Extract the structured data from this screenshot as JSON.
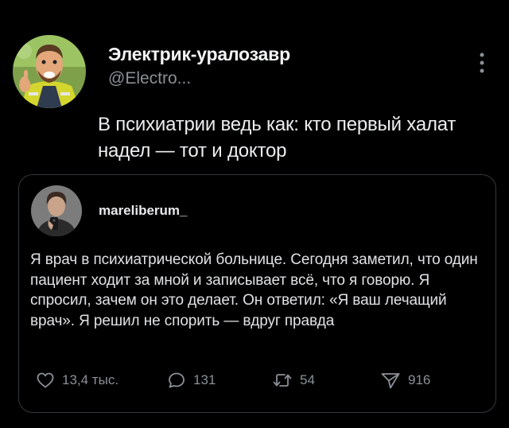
{
  "post": {
    "author_name": "Электрик-уралозавр",
    "author_handle": "@Electro...",
    "text": "В психиатрии ведь как: кто первый халат надел — тот и доктор",
    "avatar_icon": "cartoon-electrician-avatar-icon",
    "menu_icon": "vertical-ellipsis-icon"
  },
  "quote": {
    "author_name": "mareliberum_",
    "avatar_icon": "profile-photo-avatar-icon",
    "text": "Я врач в психиатрической больнице. Сегодня заметил, что один пациент ходит за мной и записывает всё, что я говорю. Я спросил, зачем он это делает. Он ответил: «Я ваш лечащий врач». Я решил не спорить — вдруг правда",
    "actions": {
      "likes": "13,4 тыс.",
      "replies": "131",
      "reposts": "54",
      "shares": "916"
    }
  },
  "colors": {
    "background": "#000000",
    "text": "#e7e9ea",
    "muted": "#8b9096",
    "border": "#34383c"
  }
}
